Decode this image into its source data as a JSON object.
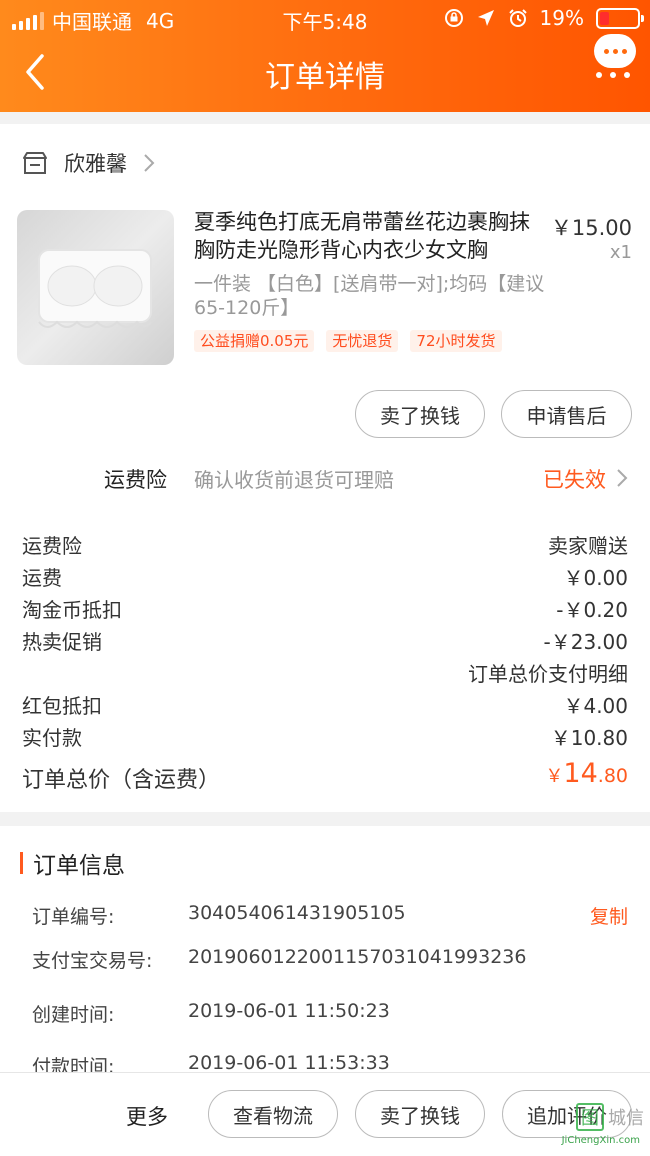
{
  "status_bar": {
    "carrier": "中国联通",
    "network": "4G",
    "time": "下午5:48",
    "battery": "19%"
  },
  "nav": {
    "title": "订单详情",
    "back_icon": "chevron-left-icon",
    "more_icon": "more-bubble-icon"
  },
  "shop": {
    "name": "欣雅馨",
    "icon": "store-icon"
  },
  "product": {
    "title": "夏季纯色打底无肩带蕾丝花边裹胸抹胸防走光隐形背心内衣少女文胸",
    "price": "￥15.00",
    "quantity": "x1",
    "sku": "一件装 【白色】[送肩带一对];均码【建议65-120斤】",
    "tags": [
      "公益捐赠0.05元",
      "无忧退货",
      "72小时发货"
    ]
  },
  "actions": {
    "sell": "卖了换钱",
    "after_sale": "申请售后"
  },
  "shipping_insurance": {
    "label": "运费险",
    "desc": "确认收货前退货可理赔",
    "status": "已失效"
  },
  "fees": [
    {
      "label": "运费险",
      "value": "卖家赠送"
    },
    {
      "label": "运费",
      "value": "￥0.00"
    },
    {
      "label": "淘金币抵扣",
      "value": "-￥0.20"
    },
    {
      "label": "热卖促销",
      "value": "-￥23.00"
    },
    {
      "label": "",
      "value": "订单总价支付明细"
    },
    {
      "label": "红包抵扣",
      "value": "￥4.00"
    },
    {
      "label": "实付款",
      "value": "￥10.80"
    }
  ],
  "total": {
    "label": "订单总价（含运费）",
    "symbol": "￥",
    "integer": "14",
    "decimal": ".80"
  },
  "order_info": {
    "title": "订单信息",
    "copy": "复制",
    "rows": [
      {
        "key": "订单编号:",
        "value": "304054061431905105"
      },
      {
        "key": "支付宝交易号:",
        "value": "2019060122001157031041993236"
      },
      {
        "key": "创建时间:",
        "value": "2019-06-01 11:50:23"
      },
      {
        "key": "付款时间:",
        "value": "2019-06-01 11:53:33"
      }
    ]
  },
  "bottom_bar": {
    "more": "更多",
    "logistics": "查看物流",
    "sell": "卖了换钱",
    "review": "追加评价"
  },
  "watermark": {
    "box": "图",
    "text": "城信",
    "domain": "JiChengXin.com"
  },
  "colors": {
    "accent": "#ff5a1f",
    "header_start": "#ff8a1c",
    "header_end": "#ff5500"
  }
}
